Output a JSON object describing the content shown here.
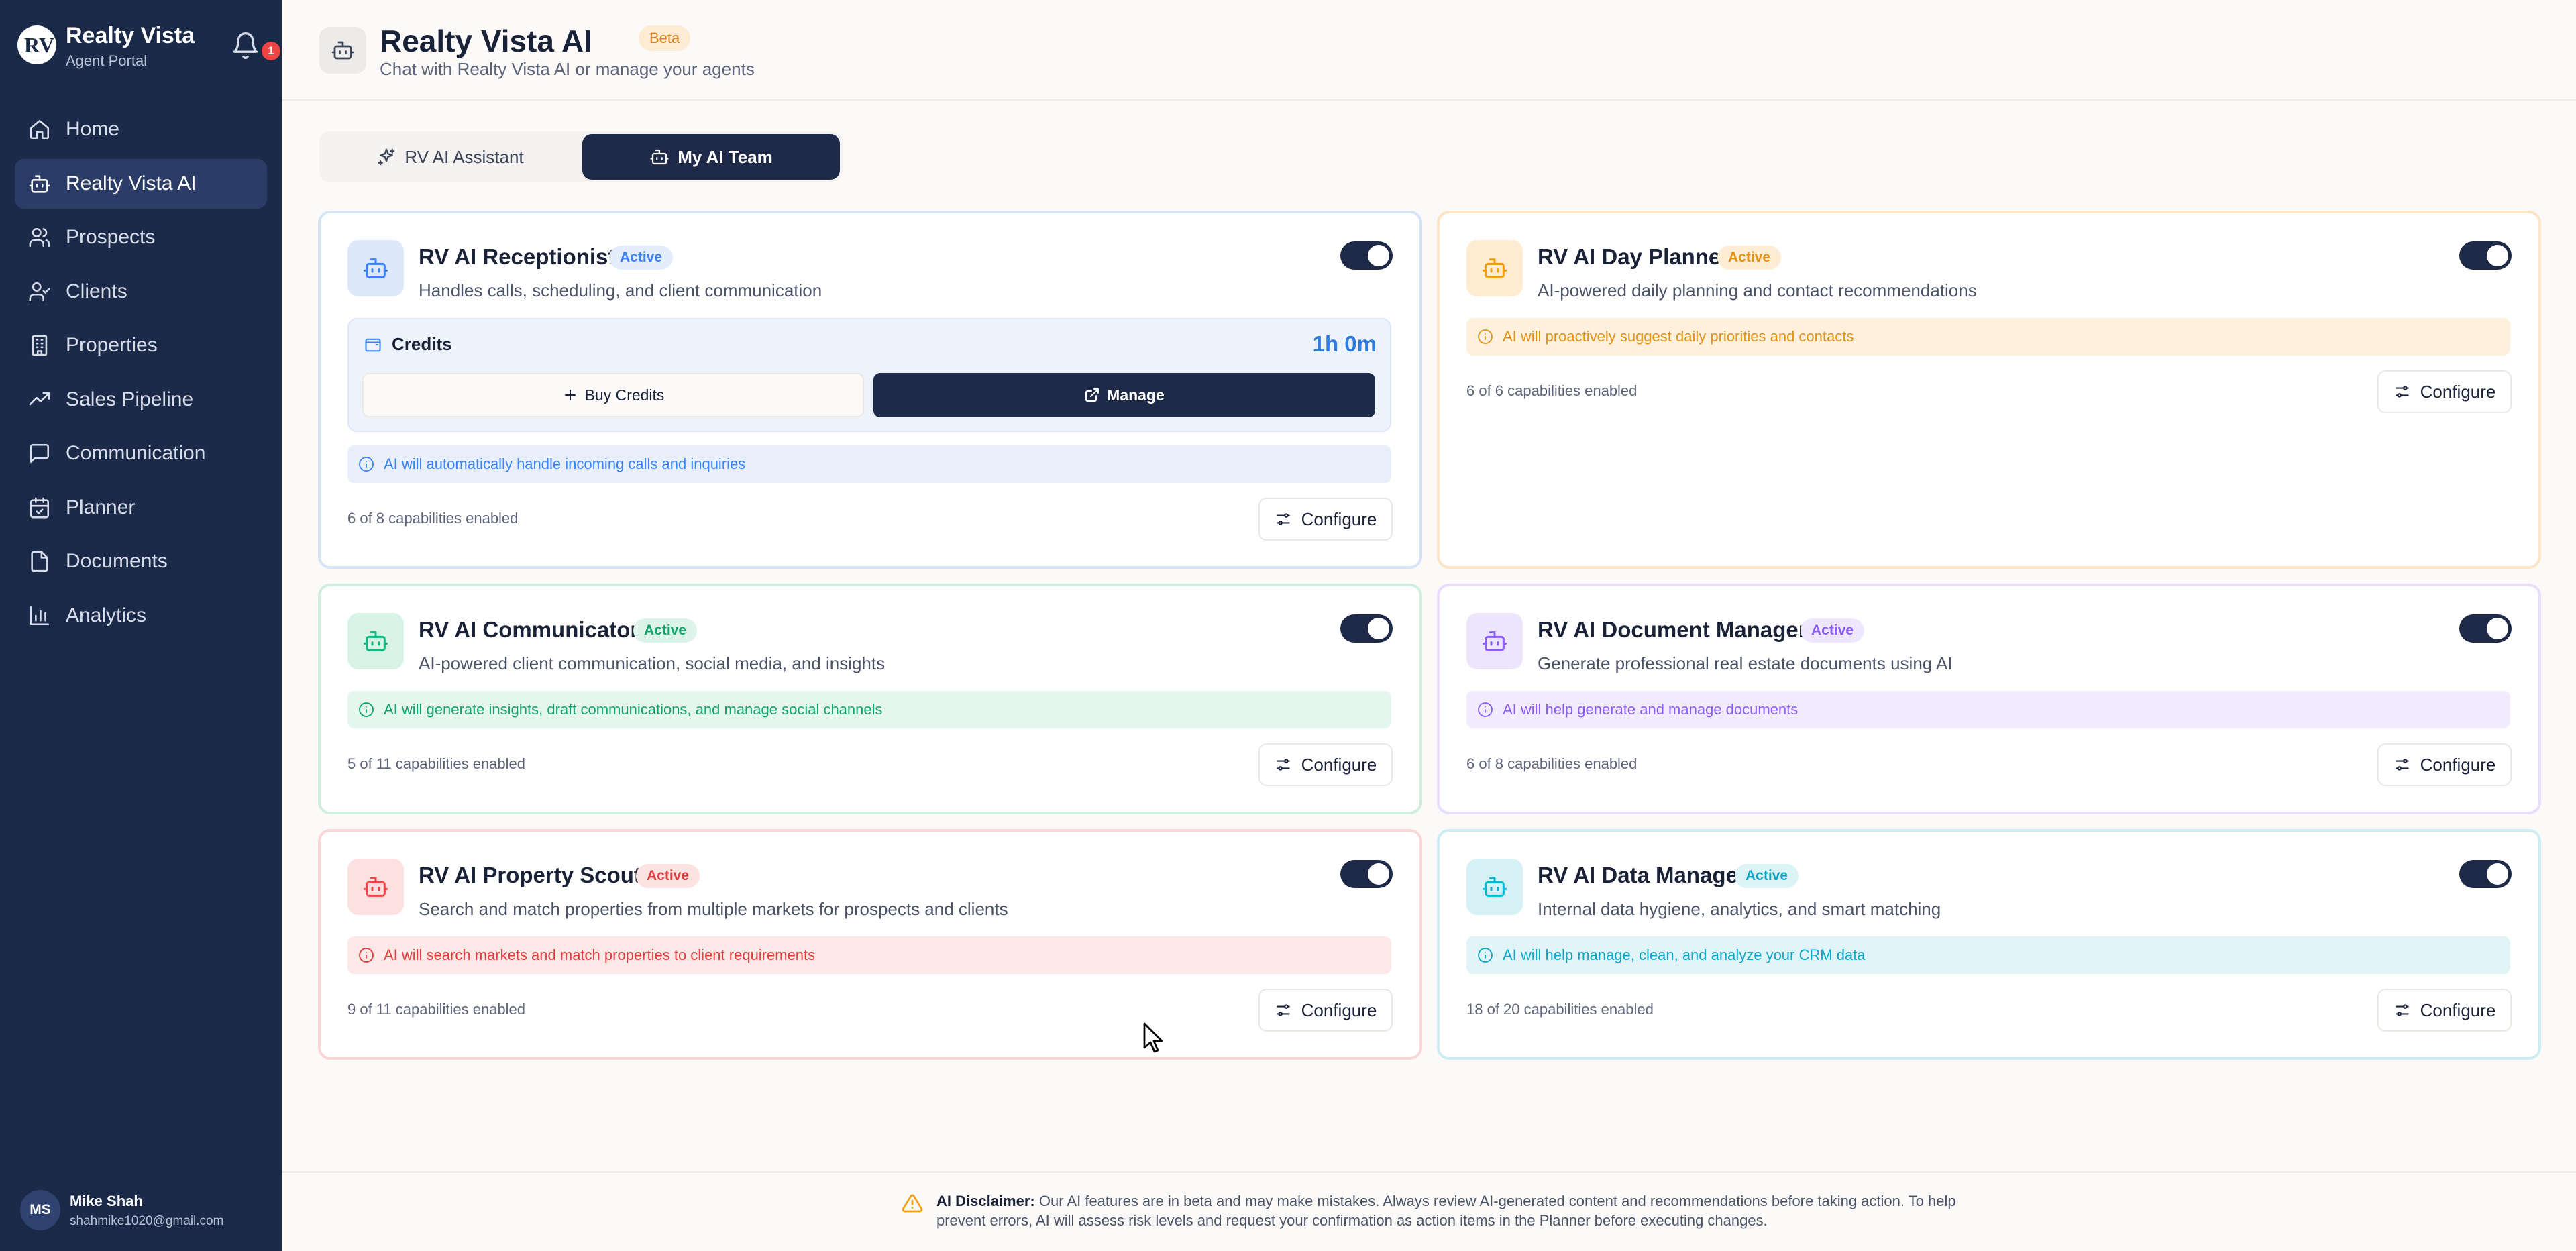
{
  "sidebar": {
    "brand_title": "Realty Vista",
    "brand_subtitle": "Agent Portal",
    "logo_text": "RV",
    "notification_count": "1",
    "items": [
      {
        "label": "Home",
        "icon": "home-icon"
      },
      {
        "label": "Realty Vista AI",
        "icon": "bot-icon",
        "active": true
      },
      {
        "label": "Prospects",
        "icon": "users-icon"
      },
      {
        "label": "Clients",
        "icon": "user-check-icon"
      },
      {
        "label": "Properties",
        "icon": "building-icon"
      },
      {
        "label": "Sales Pipeline",
        "icon": "trending-up-icon"
      },
      {
        "label": "Communication",
        "icon": "message-icon"
      },
      {
        "label": "Planner",
        "icon": "calendar-check-icon"
      },
      {
        "label": "Documents",
        "icon": "file-icon"
      },
      {
        "label": "Analytics",
        "icon": "bar-chart-icon"
      }
    ],
    "user": {
      "initials": "MS",
      "name": "Mike Shah",
      "email": "shahmike1020@gmail.com"
    }
  },
  "header": {
    "title": "Realty Vista AI",
    "badge": "Beta",
    "subtitle": "Chat with Realty Vista AI or manage your agents"
  },
  "tabs": [
    {
      "label": "RV AI Assistant",
      "icon": "sparkles-icon",
      "active": false
    },
    {
      "label": "My AI Team",
      "icon": "bot-icon",
      "active": true
    }
  ],
  "colors": {
    "sidebar_bg": "#1c2a4a",
    "primary_dark": "#1e2a48",
    "blue": "#3b82f6",
    "orange": "#f59e0b",
    "green": "#10b981",
    "purple": "#8b5cf6",
    "red": "#ef4444",
    "cyan": "#06b6d4"
  },
  "agents": {
    "receptionist": {
      "title": "RV AI Receptionist",
      "status": "Active",
      "description": "Handles calls, scheduling, and client communication",
      "enabled": true,
      "credits_label": "Credits",
      "credits_value": "1h 0m",
      "buy_label": "Buy Credits",
      "manage_label": "Manage",
      "notice": "AI will automatically handle incoming calls and inquiries",
      "capabilities": "6 of 8 capabilities enabled",
      "configure_label": "Configure"
    },
    "day_planner": {
      "title": "RV AI Day Planner",
      "status": "Active",
      "description": "AI-powered daily planning and contact recommendations",
      "enabled": true,
      "notice": "AI will proactively suggest daily priorities and contacts",
      "capabilities": "6 of 6 capabilities enabled",
      "configure_label": "Configure"
    },
    "communicator": {
      "title": "RV AI Communicator",
      "status": "Active",
      "description": "AI-powered client communication, social media, and insights",
      "enabled": true,
      "notice": "AI will generate insights, draft communications, and manage social channels",
      "capabilities": "5 of 11 capabilities enabled",
      "configure_label": "Configure"
    },
    "document_manager": {
      "title": "RV AI Document Manager",
      "status": "Active",
      "description": "Generate professional real estate documents using AI",
      "enabled": true,
      "notice": "AI will help generate and manage documents",
      "capabilities": "6 of 8 capabilities enabled",
      "configure_label": "Configure"
    },
    "property_scout": {
      "title": "RV AI Property Scout",
      "status": "Active",
      "description": "Search and match properties from multiple markets for prospects and clients",
      "enabled": true,
      "notice": "AI will search markets and match properties to client requirements",
      "capabilities": "9 of 11 capabilities enabled",
      "configure_label": "Configure"
    },
    "data_manager": {
      "title": "RV AI Data Manager",
      "status": "Active",
      "description": "Internal data hygiene, analytics, and smart matching",
      "enabled": true,
      "notice": "AI will help manage, clean, and analyze your CRM data",
      "capabilities": "18 of 20 capabilities enabled",
      "configure_label": "Configure"
    }
  },
  "footer": {
    "disclaimer_label": "AI Disclaimer:",
    "disclaimer_text": "Our AI features are in beta and may make mistakes. Always review AI-generated content and recommendations before taking action. To help prevent errors, AI will assess risk levels and request your confirmation as action items in the Planner before executing changes."
  }
}
